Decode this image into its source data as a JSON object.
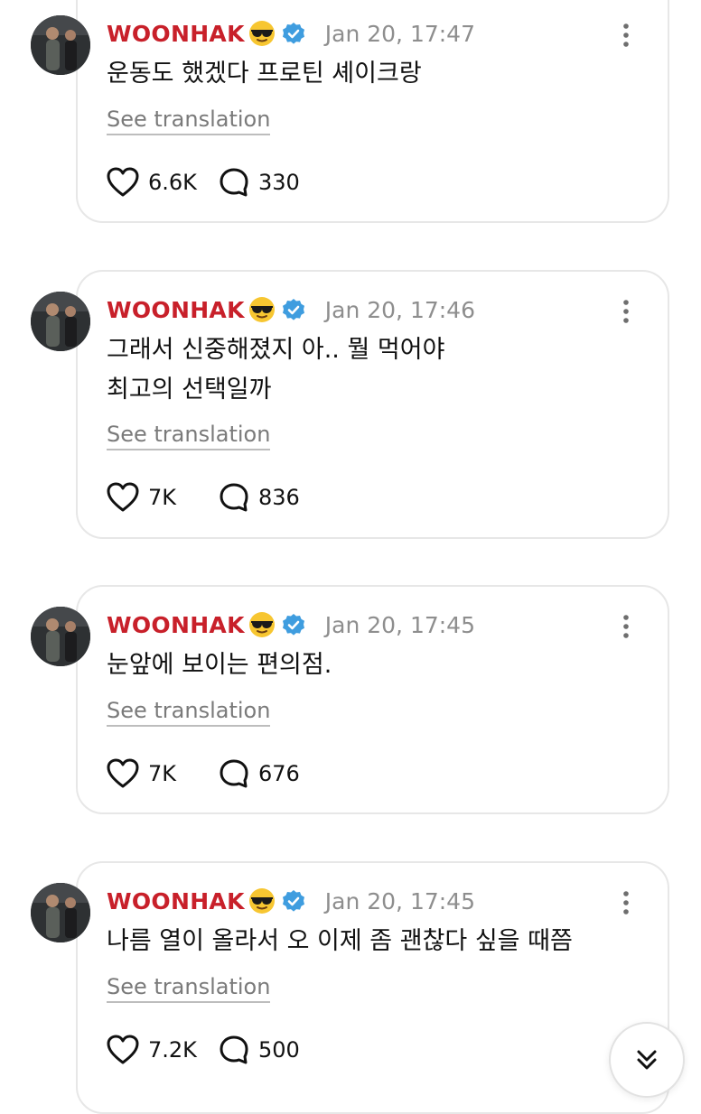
{
  "colors": {
    "author": "#c8202a",
    "verified": "#3f9ddf",
    "muted": "#8e8e8e"
  },
  "posts": [
    {
      "author": "WOONHAK",
      "author_emoji": "smiling-face-with-sunglasses",
      "timestamp": "Jan 20, 17:47",
      "lines": [
        "운동도 했겠다 프로틴 셰이크랑"
      ],
      "translate_label": "See translation",
      "likes": "6.6K",
      "replies": "330"
    },
    {
      "author": "WOONHAK",
      "author_emoji": "smiling-face-with-sunglasses",
      "timestamp": "Jan 20, 17:46",
      "lines": [
        "그래서 신중해졌지 아.. 뭘 먹어야",
        "최고의 선택일까"
      ],
      "translate_label": "See translation",
      "likes": "7K",
      "replies": "836"
    },
    {
      "author": "WOONHAK",
      "author_emoji": "smiling-face-with-sunglasses",
      "timestamp": "Jan 20, 17:45",
      "lines": [
        "눈앞에 보이는 편의점."
      ],
      "translate_label": "See translation",
      "likes": "7K",
      "replies": "676"
    },
    {
      "author": "WOONHAK",
      "author_emoji": "smiling-face-with-sunglasses",
      "timestamp": "Jan 20, 17:45",
      "lines": [
        "나름 열이 올라서 오 이제 좀 괜찮다 싶을 때쯤"
      ],
      "translate_label": "See translation",
      "likes": "7.2K",
      "replies": "500"
    }
  ],
  "icons": {
    "like": "heart-outline-icon",
    "reply": "speech-bubble-icon",
    "more": "vertical-ellipsis-icon",
    "verified": "verified-badge-icon",
    "scroll": "double-chevron-down-icon"
  }
}
